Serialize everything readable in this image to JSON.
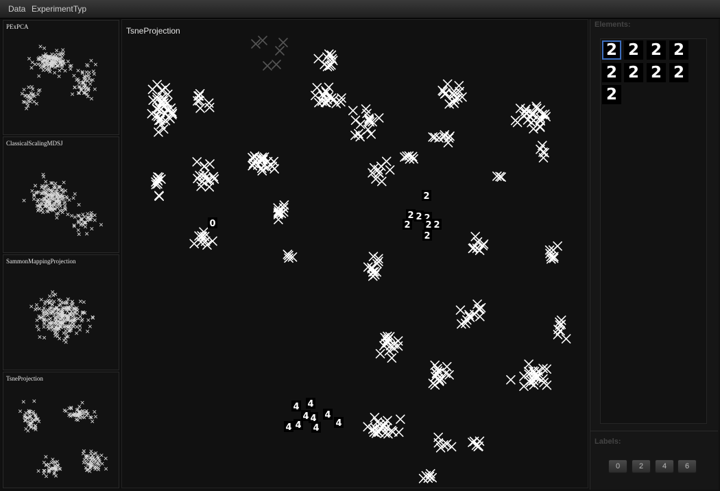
{
  "menu": {
    "items": [
      "Data",
      "ExperimentTyp"
    ]
  },
  "thumbnails": [
    {
      "label": "PExPCA"
    },
    {
      "label": "ClassicalScalingMDSJ"
    },
    {
      "label": "SammonMappingProjection"
    },
    {
      "label": "TsneProjection"
    }
  ],
  "main": {
    "title": "TsneProjection"
  },
  "elements": {
    "title": "Elements:",
    "glyphs": [
      "2",
      "2",
      "2",
      "2",
      "2",
      "2",
      "2",
      "2",
      "2"
    ],
    "selected_index": 0
  },
  "labels": {
    "title": "Labels:",
    "buttons": [
      "0",
      "2",
      "4",
      "6"
    ]
  },
  "colors": {
    "point": "#ffffff",
    "dim_point": "#555555",
    "selection": "#3d6fc0",
    "background": "#111111"
  }
}
